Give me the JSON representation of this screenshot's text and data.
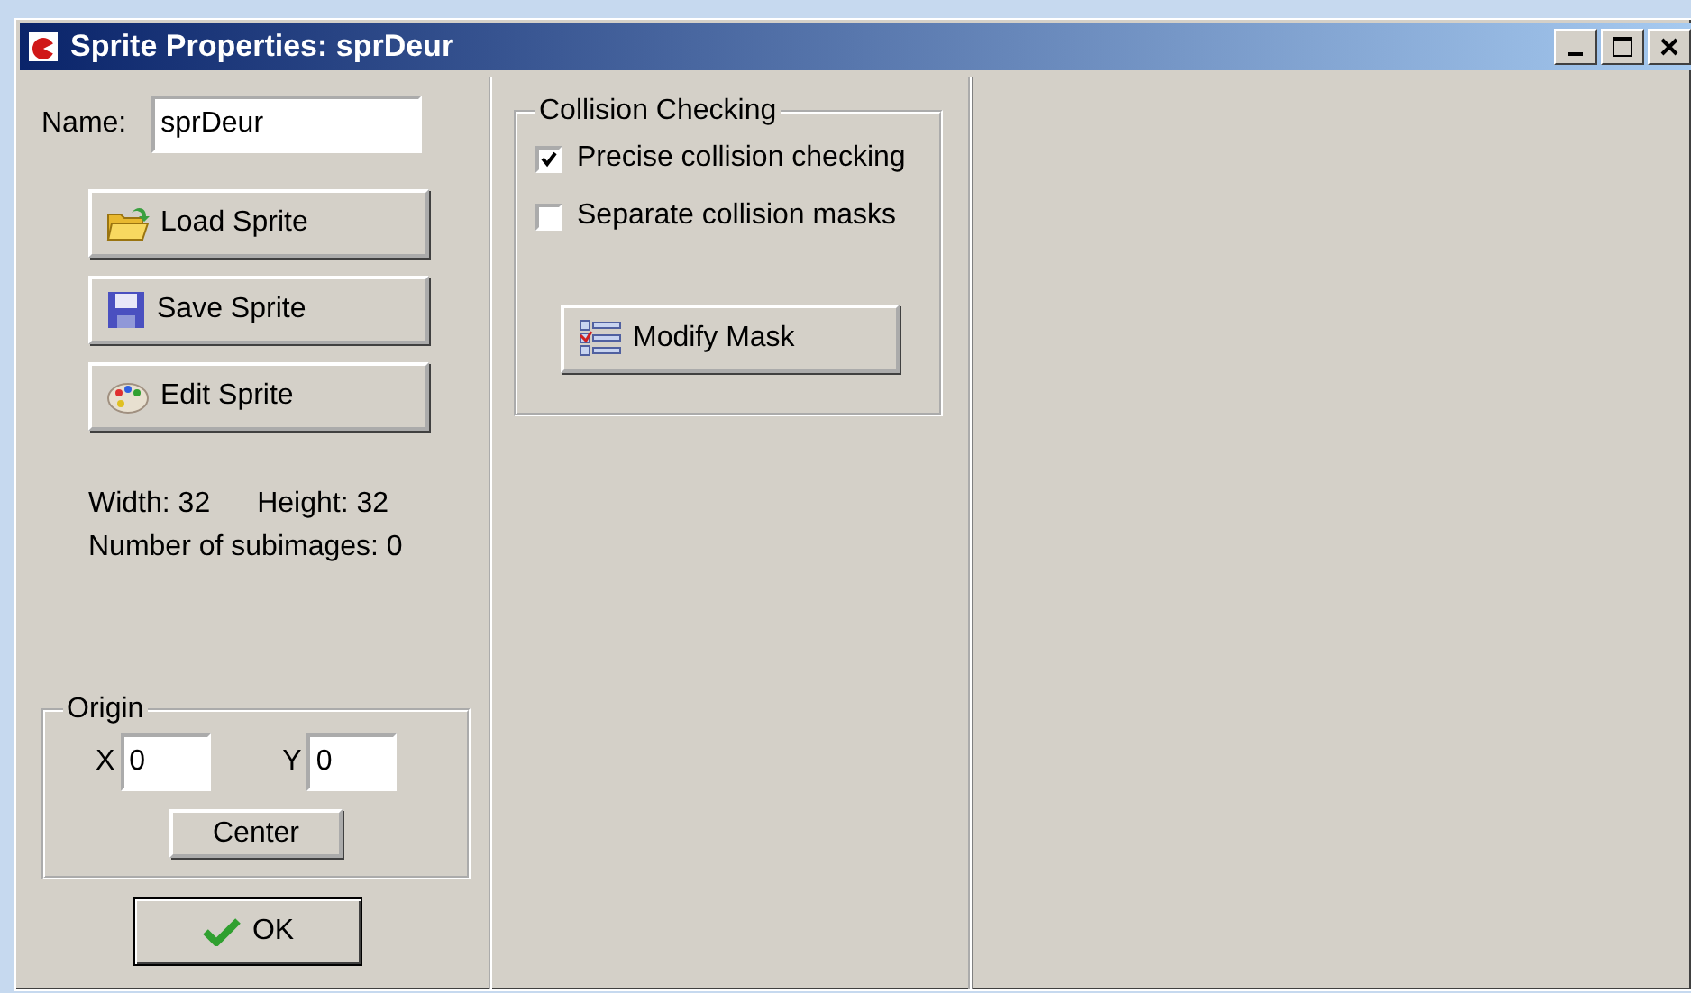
{
  "window": {
    "title": "Sprite Properties: sprDeur"
  },
  "name_field": {
    "label": "Name:",
    "value": "sprDeur"
  },
  "sprite_buttons": [
    {
      "label": "Load Sprite",
      "kind": "load"
    },
    {
      "label": "Save Sprite",
      "kind": "save"
    },
    {
      "label": "Edit Sprite",
      "kind": "edit"
    }
  ],
  "info": {
    "width": "Width: 32",
    "height": "Height: 32",
    "subimages": "Number of subimages: 0"
  },
  "origin": {
    "title": "Origin",
    "x_label": "X",
    "x_value": "0",
    "y_label": "Y",
    "y_value": "0",
    "center_button": "Center"
  },
  "ok_button": "OK",
  "collision": {
    "title": "Collision Checking",
    "options": [
      {
        "label": "Precise collision checking",
        "checked": true
      },
      {
        "label": "Separate collision masks",
        "checked": false
      }
    ],
    "modify_mask_button": "Modify Mask"
  }
}
